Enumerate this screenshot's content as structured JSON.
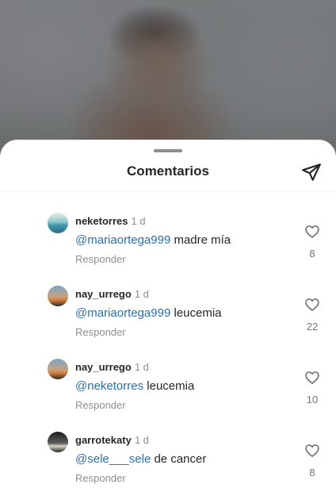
{
  "sheet": {
    "title": "Comentarios",
    "share_icon": "send-icon"
  },
  "comments": [
    {
      "username": "neketorres",
      "time": "1 d",
      "mention": "@mariaortega999",
      "text": " madre mía",
      "reply_label": "Responder",
      "likes": "8",
      "avatar": "beach-photo"
    },
    {
      "username": "nay_urrego",
      "time": "1 d",
      "mention": "@mariaortega999",
      "text": " leucemia",
      "reply_label": "Responder",
      "likes": "22",
      "avatar": "sunset-photo"
    },
    {
      "username": "nay_urrego",
      "time": "1 d",
      "mention": "@neketorres",
      "text": " leucemia",
      "reply_label": "Responder",
      "likes": "10",
      "avatar": "sunset-photo"
    },
    {
      "username": "garrotekaty",
      "time": "1 d",
      "mention": "@sele___sele",
      "text": " de cancer",
      "reply_label": "Responder",
      "likes": "8",
      "avatar": "dark-photo"
    }
  ],
  "colors": {
    "mention": "#2f6ea8",
    "secondary_text": "#8e8e8e",
    "primary_text": "#262626"
  }
}
